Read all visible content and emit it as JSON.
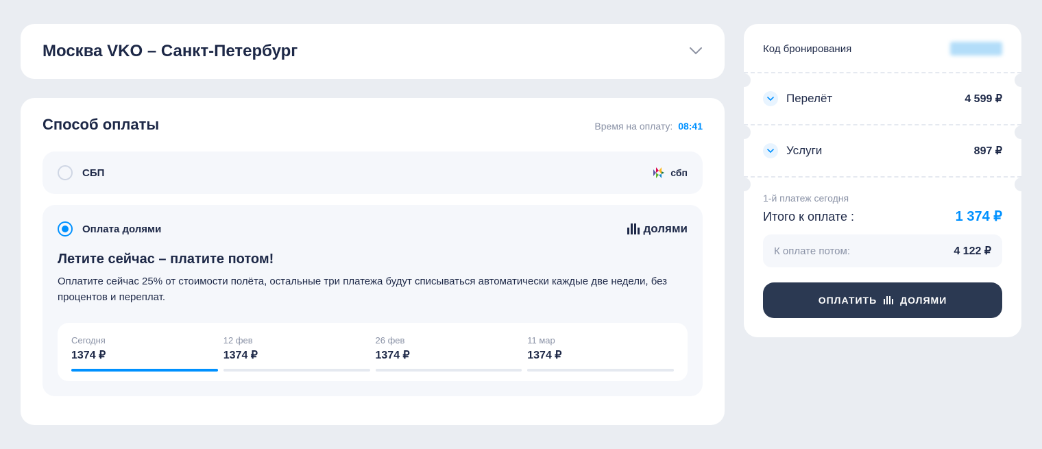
{
  "route": {
    "title": "Москва VKO – Санкт-Петербург"
  },
  "payment": {
    "title": "Способ оплаты",
    "timer_label": "Время на оплату:",
    "timer_value": "08:41",
    "options": {
      "sbp": {
        "label": "СБП",
        "logo_text": "сбп"
      },
      "dolyami": {
        "label": "Оплата долями",
        "logo_text": "долями",
        "headline": "Летите сейчас – платите потом!",
        "desc": "Оплатите сейчас 25% от стоимости полёта, остальные три платежа будут списываться автоматически каждые две недели, без процентов и переплат.",
        "schedule": [
          {
            "date": "Сегодня",
            "amount": "1374 ₽",
            "active": true
          },
          {
            "date": "12 фев",
            "amount": "1374 ₽",
            "active": false
          },
          {
            "date": "26 фев",
            "amount": "1374 ₽",
            "active": false
          },
          {
            "date": "11 мар",
            "amount": "1374 ₽",
            "active": false
          }
        ]
      }
    }
  },
  "sidebar": {
    "booking_label": "Код бронирования",
    "lines": {
      "flight": {
        "label": "Перелёт",
        "value": "4 599 ₽"
      },
      "services": {
        "label": "Услуги",
        "value": "897 ₽"
      }
    },
    "first_payment_note": "1-й платеж сегодня",
    "total_label": "Итого к оплате :",
    "total_value": "1 374 ₽",
    "later_label": "К оплате потом:",
    "later_value": "4 122 ₽",
    "button_label": "ОПЛАТИТЬ",
    "button_suffix": "ДОЛЯМИ"
  }
}
